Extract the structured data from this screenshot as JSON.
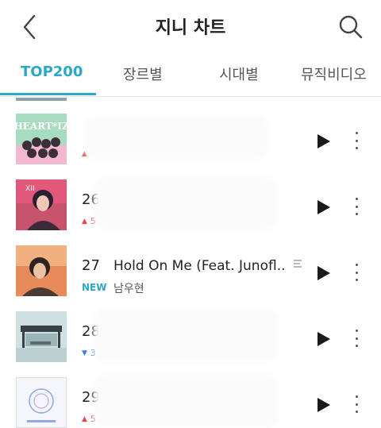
{
  "header": {
    "title": "지니 차트",
    "icons": {
      "back": "chevron-left-icon",
      "search": "search-icon"
    }
  },
  "tabs": [
    {
      "label": "TOP200",
      "active": true
    },
    {
      "label": "장르별",
      "active": false
    },
    {
      "label": "시대별",
      "active": false
    },
    {
      "label": "뮤직비디오",
      "active": false
    }
  ],
  "rows": [
    {
      "rank": "",
      "change": "up",
      "change_value": "",
      "title": "",
      "artist": ""
    },
    {
      "rank": "26",
      "change": "up",
      "change_value": "5",
      "title": "",
      "artist": ""
    },
    {
      "rank": "27",
      "change": "new",
      "change_value": "NEW",
      "title": "Hold On Me (Feat. Junofl..",
      "artist": "남우현"
    },
    {
      "rank": "28",
      "change": "down",
      "change_value": "3",
      "title": "",
      "artist": ""
    },
    {
      "rank": "29",
      "change": "up",
      "change_value": "5",
      "title": "",
      "artist": ""
    }
  ],
  "colors": {
    "accent": "#2aa8c9",
    "up": "#e0484a",
    "down": "#3f7fd8"
  }
}
